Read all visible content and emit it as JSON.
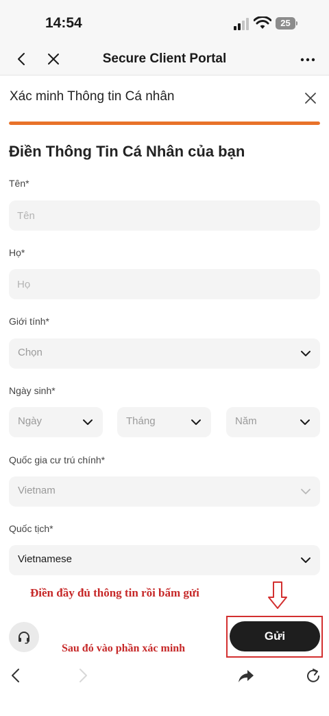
{
  "status_bar": {
    "time": "14:54",
    "battery": "25"
  },
  "nav": {
    "title": "Secure Client Portal"
  },
  "sheet": {
    "title": "Xác minh Thông tin Cá nhân",
    "progress": 1.0
  },
  "form": {
    "heading": "Điền Thông Tin Cá Nhân của bạn",
    "first_name": {
      "label": "Tên*",
      "placeholder": "Tên",
      "value": ""
    },
    "last_name": {
      "label": "Họ*",
      "placeholder": "Họ",
      "value": ""
    },
    "gender": {
      "label": "Giới tính*",
      "value": "Chọn"
    },
    "dob": {
      "label": "Ngày sinh*",
      "day": "Ngày",
      "month": "Tháng",
      "year": "Năm"
    },
    "residence": {
      "label": "Quốc gia cư trú chính*",
      "value": "Vietnam"
    },
    "nationality": {
      "label": "Quốc tịch*",
      "value": "Vietnamese"
    }
  },
  "annotations": {
    "line1": "Điền đầy đủ thông tin rồi bấm gửi",
    "line2": "Sau đó vào phần xác minh",
    "color": "#c62828"
  },
  "actions": {
    "submit_label": "Gửi"
  },
  "colors": {
    "accent": "#e8722a",
    "button": "#1e1e1e",
    "field_bg": "#f4f4f4"
  },
  "icons": {
    "nav": [
      "chevron-left-icon",
      "close-icon",
      "more-icon"
    ],
    "browser": [
      "back-icon",
      "forward-icon",
      "share-icon",
      "reload-icon"
    ],
    "support": "headset-icon"
  }
}
